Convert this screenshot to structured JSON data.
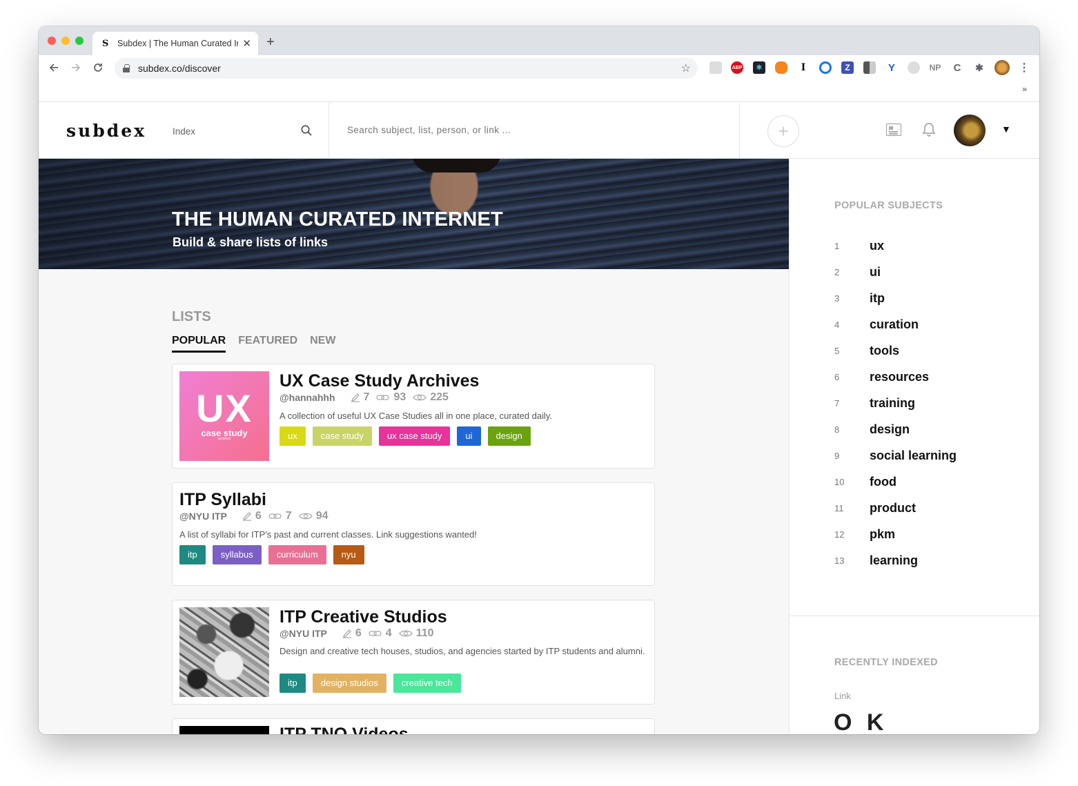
{
  "browser": {
    "tab_favicon": "S",
    "tab_title": "Subdex | The Human Curated Internet",
    "tab_close": "✕",
    "new_tab": "+",
    "url": "subdex.co/discover",
    "bookmarks_more": "»",
    "extensions": [
      "ABP",
      "I",
      "Z",
      "NP",
      "C"
    ]
  },
  "header": {
    "logo": "subdex",
    "index_label": "Index",
    "search_placeholder": "Search subject, list, person, or link ...",
    "add_label": "+",
    "caret": "▼"
  },
  "hero": {
    "title": "THE HUMAN CURATED INTERNET",
    "subtitle": "Build & share lists of links"
  },
  "lists": {
    "heading": "LISTS",
    "tabs": [
      "POPULAR",
      "FEATURED",
      "NEW"
    ],
    "cards": [
      {
        "title": "UX Case Study Archives",
        "author": "@hannahhh",
        "contributors": "7",
        "links": "93",
        "views": "225",
        "description": "A collection of useful UX Case Studies all in one place, curated daily.",
        "thumb_big": "UX",
        "thumb_small": "case study",
        "thumb_tiny": "archives",
        "tags": [
          {
            "label": "ux",
            "color": "#d9d914"
          },
          {
            "label": "case study",
            "color": "#c9d467"
          },
          {
            "label": "ux case study",
            "color": "#e7339a"
          },
          {
            "label": "ui",
            "color": "#1f66d8"
          },
          {
            "label": "design",
            "color": "#6aa30f"
          }
        ]
      },
      {
        "title": "ITP Syllabi",
        "author": "@NYU ITP",
        "contributors": "6",
        "links": "7",
        "views": "94",
        "description": "A list of syllabi for ITP's past and current classes. Link suggestions wanted!",
        "tags": [
          {
            "label": "itp",
            "color": "#1e8a82"
          },
          {
            "label": "syllabus",
            "color": "#7b5fc4"
          },
          {
            "label": "curriculum",
            "color": "#ea6f95"
          },
          {
            "label": "nyu",
            "color": "#b85a14"
          }
        ]
      },
      {
        "title": "ITP Creative Studios",
        "author": "@NYU ITP",
        "contributors": "6",
        "links": "4",
        "views": "110",
        "description": "Design and creative tech houses, studios, and agencies started by ITP students and alumni.",
        "tags": [
          {
            "label": "itp",
            "color": "#1e8a82"
          },
          {
            "label": "design studios",
            "color": "#e2b264"
          },
          {
            "label": "creative tech",
            "color": "#4ae69a"
          }
        ]
      },
      {
        "title": "ITP TNO Videos"
      }
    ]
  },
  "sidebar": {
    "popular_heading": "POPULAR SUBJECTS",
    "subjects": [
      {
        "num": "1",
        "name": "ux"
      },
      {
        "num": "2",
        "name": "ui"
      },
      {
        "num": "3",
        "name": "itp"
      },
      {
        "num": "4",
        "name": "curation"
      },
      {
        "num": "5",
        "name": "tools"
      },
      {
        "num": "6",
        "name": "resources"
      },
      {
        "num": "7",
        "name": "training"
      },
      {
        "num": "8",
        "name": "design"
      },
      {
        "num": "9",
        "name": "social learning"
      },
      {
        "num": "10",
        "name": "food"
      },
      {
        "num": "11",
        "name": "product"
      },
      {
        "num": "12",
        "name": "pkm"
      },
      {
        "num": "13",
        "name": "learning"
      }
    ],
    "recent_heading": "RECENTLY INDEXED",
    "recent_type": "Link",
    "recent_logo": "O K"
  }
}
